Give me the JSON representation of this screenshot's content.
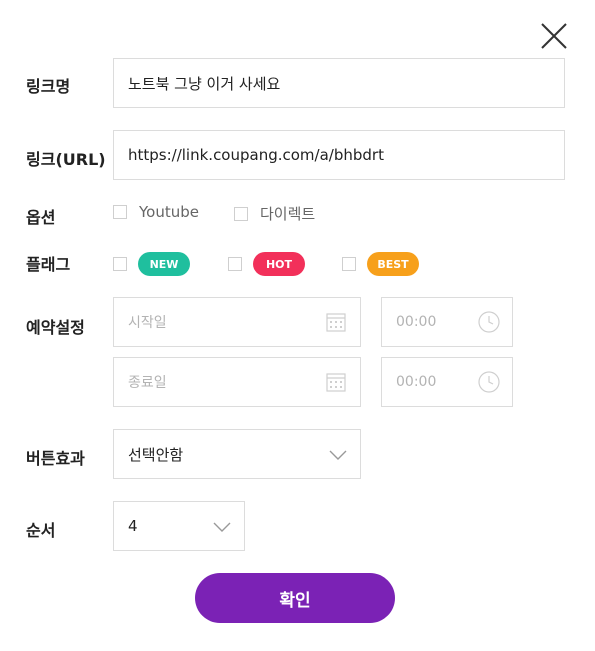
{
  "labels": {
    "link_name": "링크명",
    "link_url": "링크(URL)",
    "options": "옵션",
    "flag": "플래그",
    "schedule": "예약설정",
    "button_effect": "버튼효과",
    "order": "순서"
  },
  "fields": {
    "link_name_value": "노트북 그냥 이거 사세요",
    "link_url_value": "https://link.coupang.com/a/bhbdrt",
    "start_date_placeholder": "시작일",
    "end_date_placeholder": "종료일",
    "start_time_placeholder": "00:00",
    "end_time_placeholder": "00:00",
    "button_effect_value": "선택안함",
    "order_value": "4"
  },
  "options": [
    "Youtube",
    "다이렉트"
  ],
  "flags": [
    {
      "label": "NEW",
      "color": "#1fbf9e"
    },
    {
      "label": "HOT",
      "color": "#f2305a"
    },
    {
      "label": "BEST",
      "color": "#f7a01b"
    }
  ],
  "confirm_label": "확인",
  "colors": {
    "accent": "#7b22b5"
  },
  "icons": {
    "close": "close-icon",
    "calendar": "calendar-icon",
    "clock": "clock-icon",
    "dropdown": "chevron-down-icon"
  }
}
